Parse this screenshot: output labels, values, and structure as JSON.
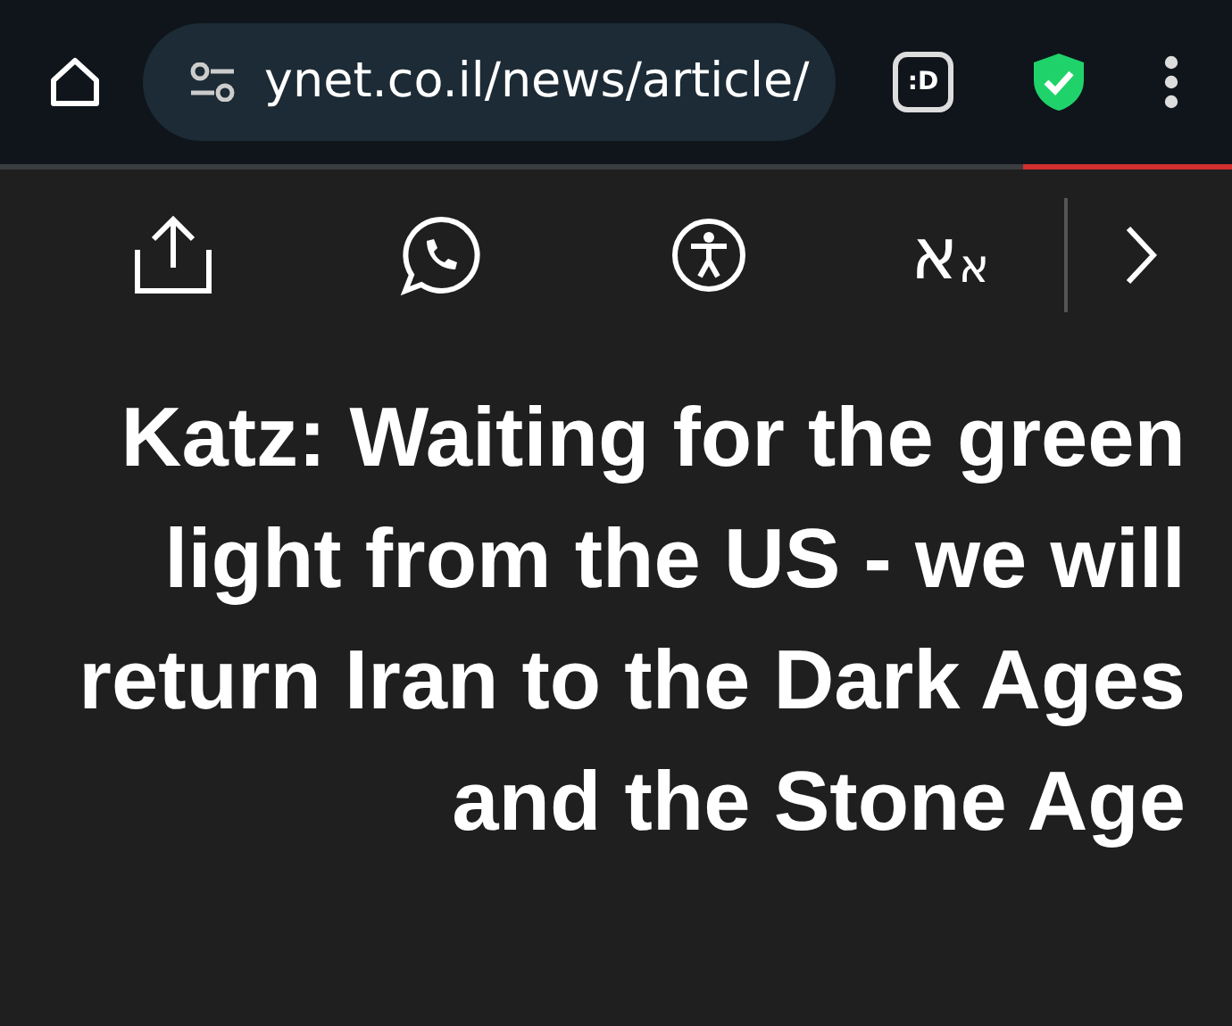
{
  "browser_bar": {
    "url": "ynet.co.il/news/article/",
    "extension_badge": ":D"
  },
  "reading_progress": {
    "level": 0.17
  },
  "article_toolbar": {
    "text_size": {
      "small": "א",
      "large": "א"
    }
  },
  "headline": "Katz: Waiting for the green light from the US - we will return Iran to the Dark Ages and the Stone Age"
}
